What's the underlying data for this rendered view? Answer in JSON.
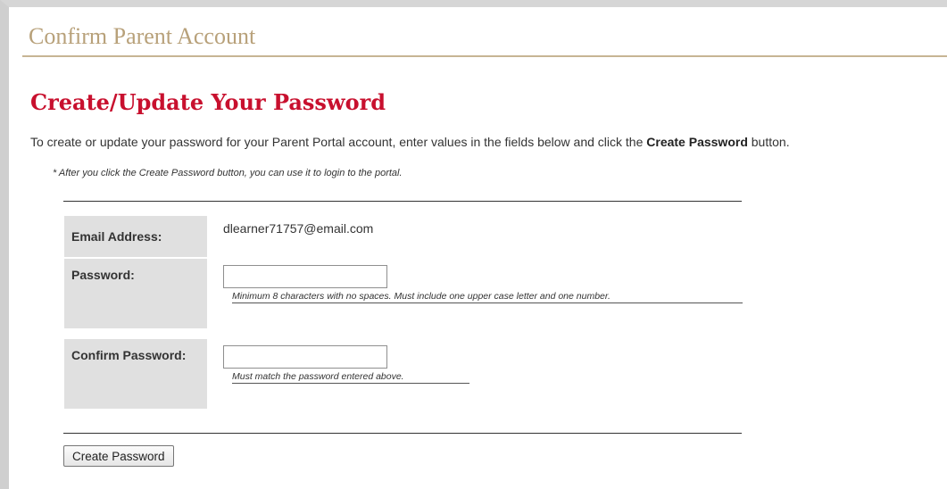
{
  "page": {
    "title": "Confirm Parent Account"
  },
  "section": {
    "heading": "Create/Update Your Password",
    "intro_before": "To create or update your password for your Parent Portal account, enter values in the fields below and click the ",
    "intro_bold": "Create Password",
    "intro_after": " button.",
    "note": "* After you click the Create Password button, you can use it to login to the portal."
  },
  "form": {
    "email": {
      "label": "Email Address:",
      "value": "dlearner71757@email.com"
    },
    "password": {
      "label": "Password:",
      "value": "",
      "hint": "Minimum 8 characters with no spaces. Must include one upper case letter and one number."
    },
    "confirm_password": {
      "label": "Confirm Password:",
      "value": "",
      "hint": "Must match the password entered above."
    },
    "submit_label": "Create Password"
  },
  "colors": {
    "title": "#b8a17a",
    "heading": "#c8102e",
    "label_bg": "#e0e0e0"
  }
}
